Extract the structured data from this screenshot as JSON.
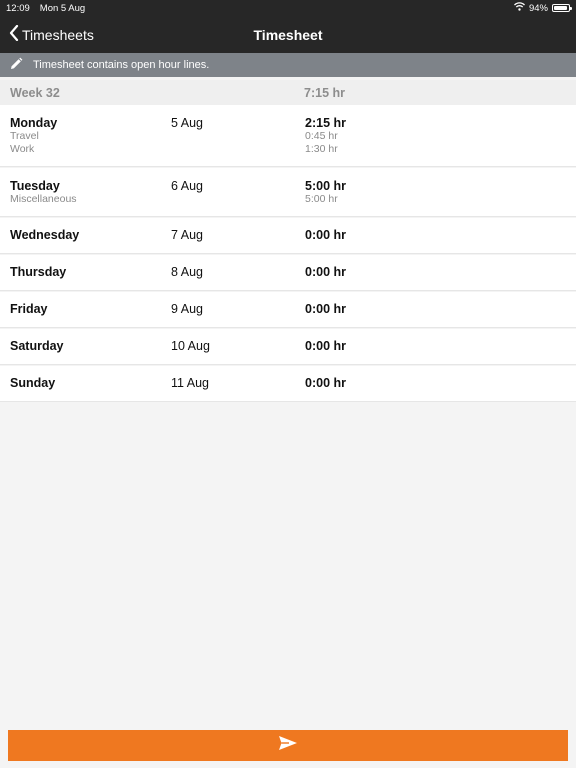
{
  "status": {
    "time": "12:09",
    "date": "Mon 5 Aug",
    "battery": "94%",
    "battery_level": 0.94
  },
  "nav": {
    "back_label": "Timesheets",
    "title": "Timesheet"
  },
  "notice": {
    "text": "Timesheet contains open hour lines."
  },
  "week": {
    "label": "Week 32",
    "total": "7:15 hr"
  },
  "days": [
    {
      "name": "Monday",
      "date": "5 Aug",
      "hours": "2:15 hr",
      "lines": [
        {
          "type": "Travel",
          "hours": "0:45 hr"
        },
        {
          "type": "Work",
          "hours": "1:30 hr"
        }
      ]
    },
    {
      "name": "Tuesday",
      "date": "6 Aug",
      "hours": "5:00 hr",
      "lines": [
        {
          "type": "Miscellaneous",
          "hours": "5:00 hr"
        }
      ]
    },
    {
      "name": "Wednesday",
      "date": "7 Aug",
      "hours": "0:00 hr",
      "lines": []
    },
    {
      "name": "Thursday",
      "date": "8 Aug",
      "hours": "0:00 hr",
      "lines": []
    },
    {
      "name": "Friday",
      "date": "9 Aug",
      "hours": "0:00 hr",
      "lines": []
    },
    {
      "name": "Saturday",
      "date": "10 Aug",
      "hours": "0:00 hr",
      "lines": []
    },
    {
      "name": "Sunday",
      "date": "11 Aug",
      "hours": "0:00 hr",
      "lines": []
    }
  ],
  "colors": {
    "accent": "#ef7820",
    "header": "#272727",
    "notice": "#7e8389"
  },
  "icons": {
    "back": "chevron-left-icon",
    "notice": "pencil-icon",
    "send": "send-icon"
  }
}
